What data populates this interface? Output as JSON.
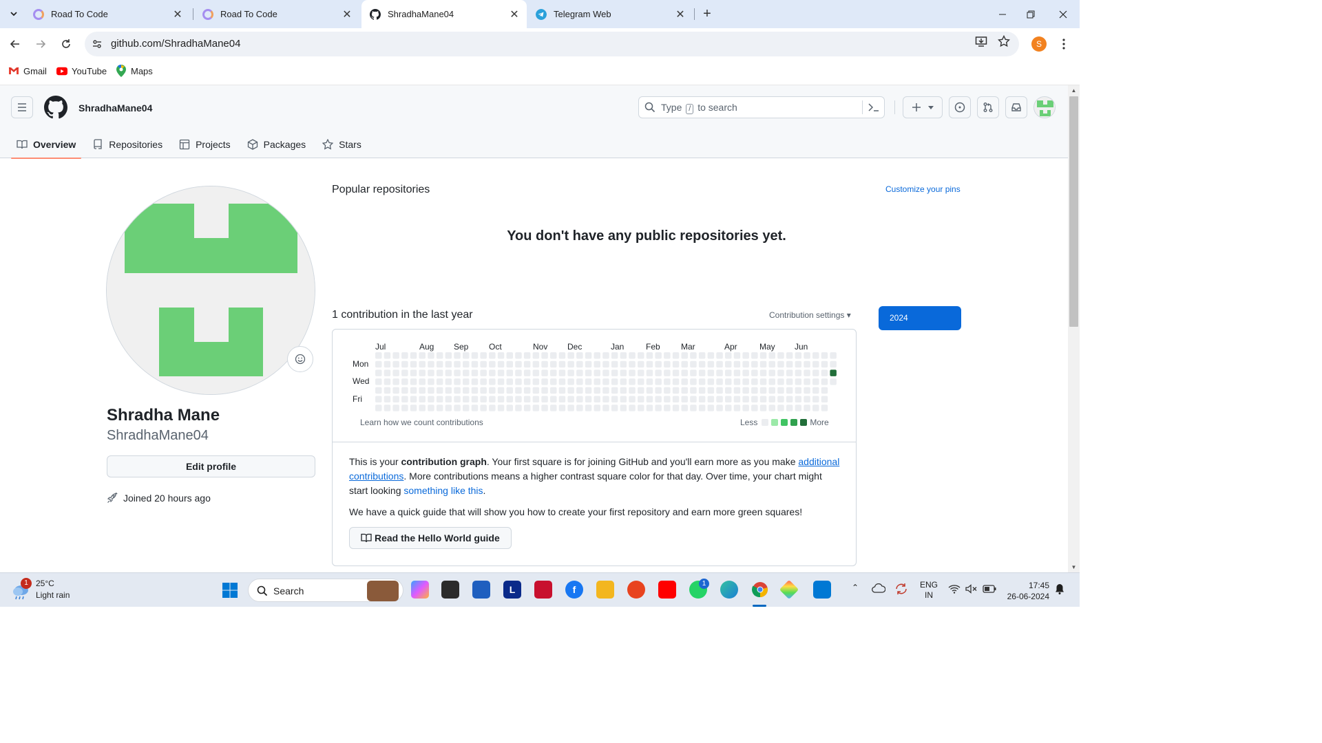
{
  "browser": {
    "tabs": [
      {
        "title": "Road To Code",
        "active": false
      },
      {
        "title": "Road To Code",
        "active": false
      },
      {
        "title": "ShradhaMane04",
        "active": true
      },
      {
        "title": "Telegram Web",
        "active": false
      }
    ],
    "url": "github.com/ShradhaMane04",
    "profile_initial": "S",
    "bookmarks": [
      "Gmail",
      "YouTube",
      "Maps"
    ]
  },
  "github": {
    "header_username": "ShradhaMane04",
    "search_prefix": "Type",
    "search_key": "/",
    "search_suffix": "to search",
    "nav_tabs": [
      "Overview",
      "Repositories",
      "Projects",
      "Packages",
      "Stars"
    ],
    "profile": {
      "full_name": "Shradha Mane",
      "login": "ShradhaMane04",
      "edit_label": "Edit profile",
      "joined": "Joined 20 hours ago"
    },
    "popular_title": "Popular repositories",
    "customize_pins": "Customize your pins",
    "empty_repos": "You don't have any public repositories yet.",
    "contrib_title": "1 contribution in the last year",
    "contrib_settings": "Contribution settings ▾",
    "year": "2024",
    "months": [
      "Jul",
      "Aug",
      "Sep",
      "Oct",
      "Nov",
      "Dec",
      "Jan",
      "Feb",
      "Mar",
      "Apr",
      "May",
      "Jun"
    ],
    "day_labels": [
      "Mon",
      "Wed",
      "Fri"
    ],
    "contribution_count": 1,
    "learn_link": "Learn how we count contributions",
    "legend_less": "Less",
    "legend_more": "More",
    "legend_colors": [
      "#ebedf0",
      "#9be9a8",
      "#40c463",
      "#30a14e",
      "#216e39"
    ],
    "info": {
      "p1_a": "This is your ",
      "p1_bold": "contribution graph",
      "p1_b": ". Your first square is for joining GitHub and you'll earn more as you make ",
      "p1_link1": "additional contributions",
      "p1_c": ". More contributions means a higher contrast square color for that day. Over time, your chart might start looking ",
      "p1_link2": "something like this",
      "p1_d": ".",
      "p2": "We have a quick guide that will show you how to create your first repository and earn more green squares!",
      "button": "Read the Hello World guide"
    }
  },
  "taskbar": {
    "weather_temp": "25°C",
    "weather_cond": "Light rain",
    "weather_badge": "1",
    "search": "Search",
    "lang_1": "ENG",
    "lang_2": "IN",
    "time": "17:45",
    "date": "26-06-2024",
    "whatsapp_badge": "1"
  }
}
